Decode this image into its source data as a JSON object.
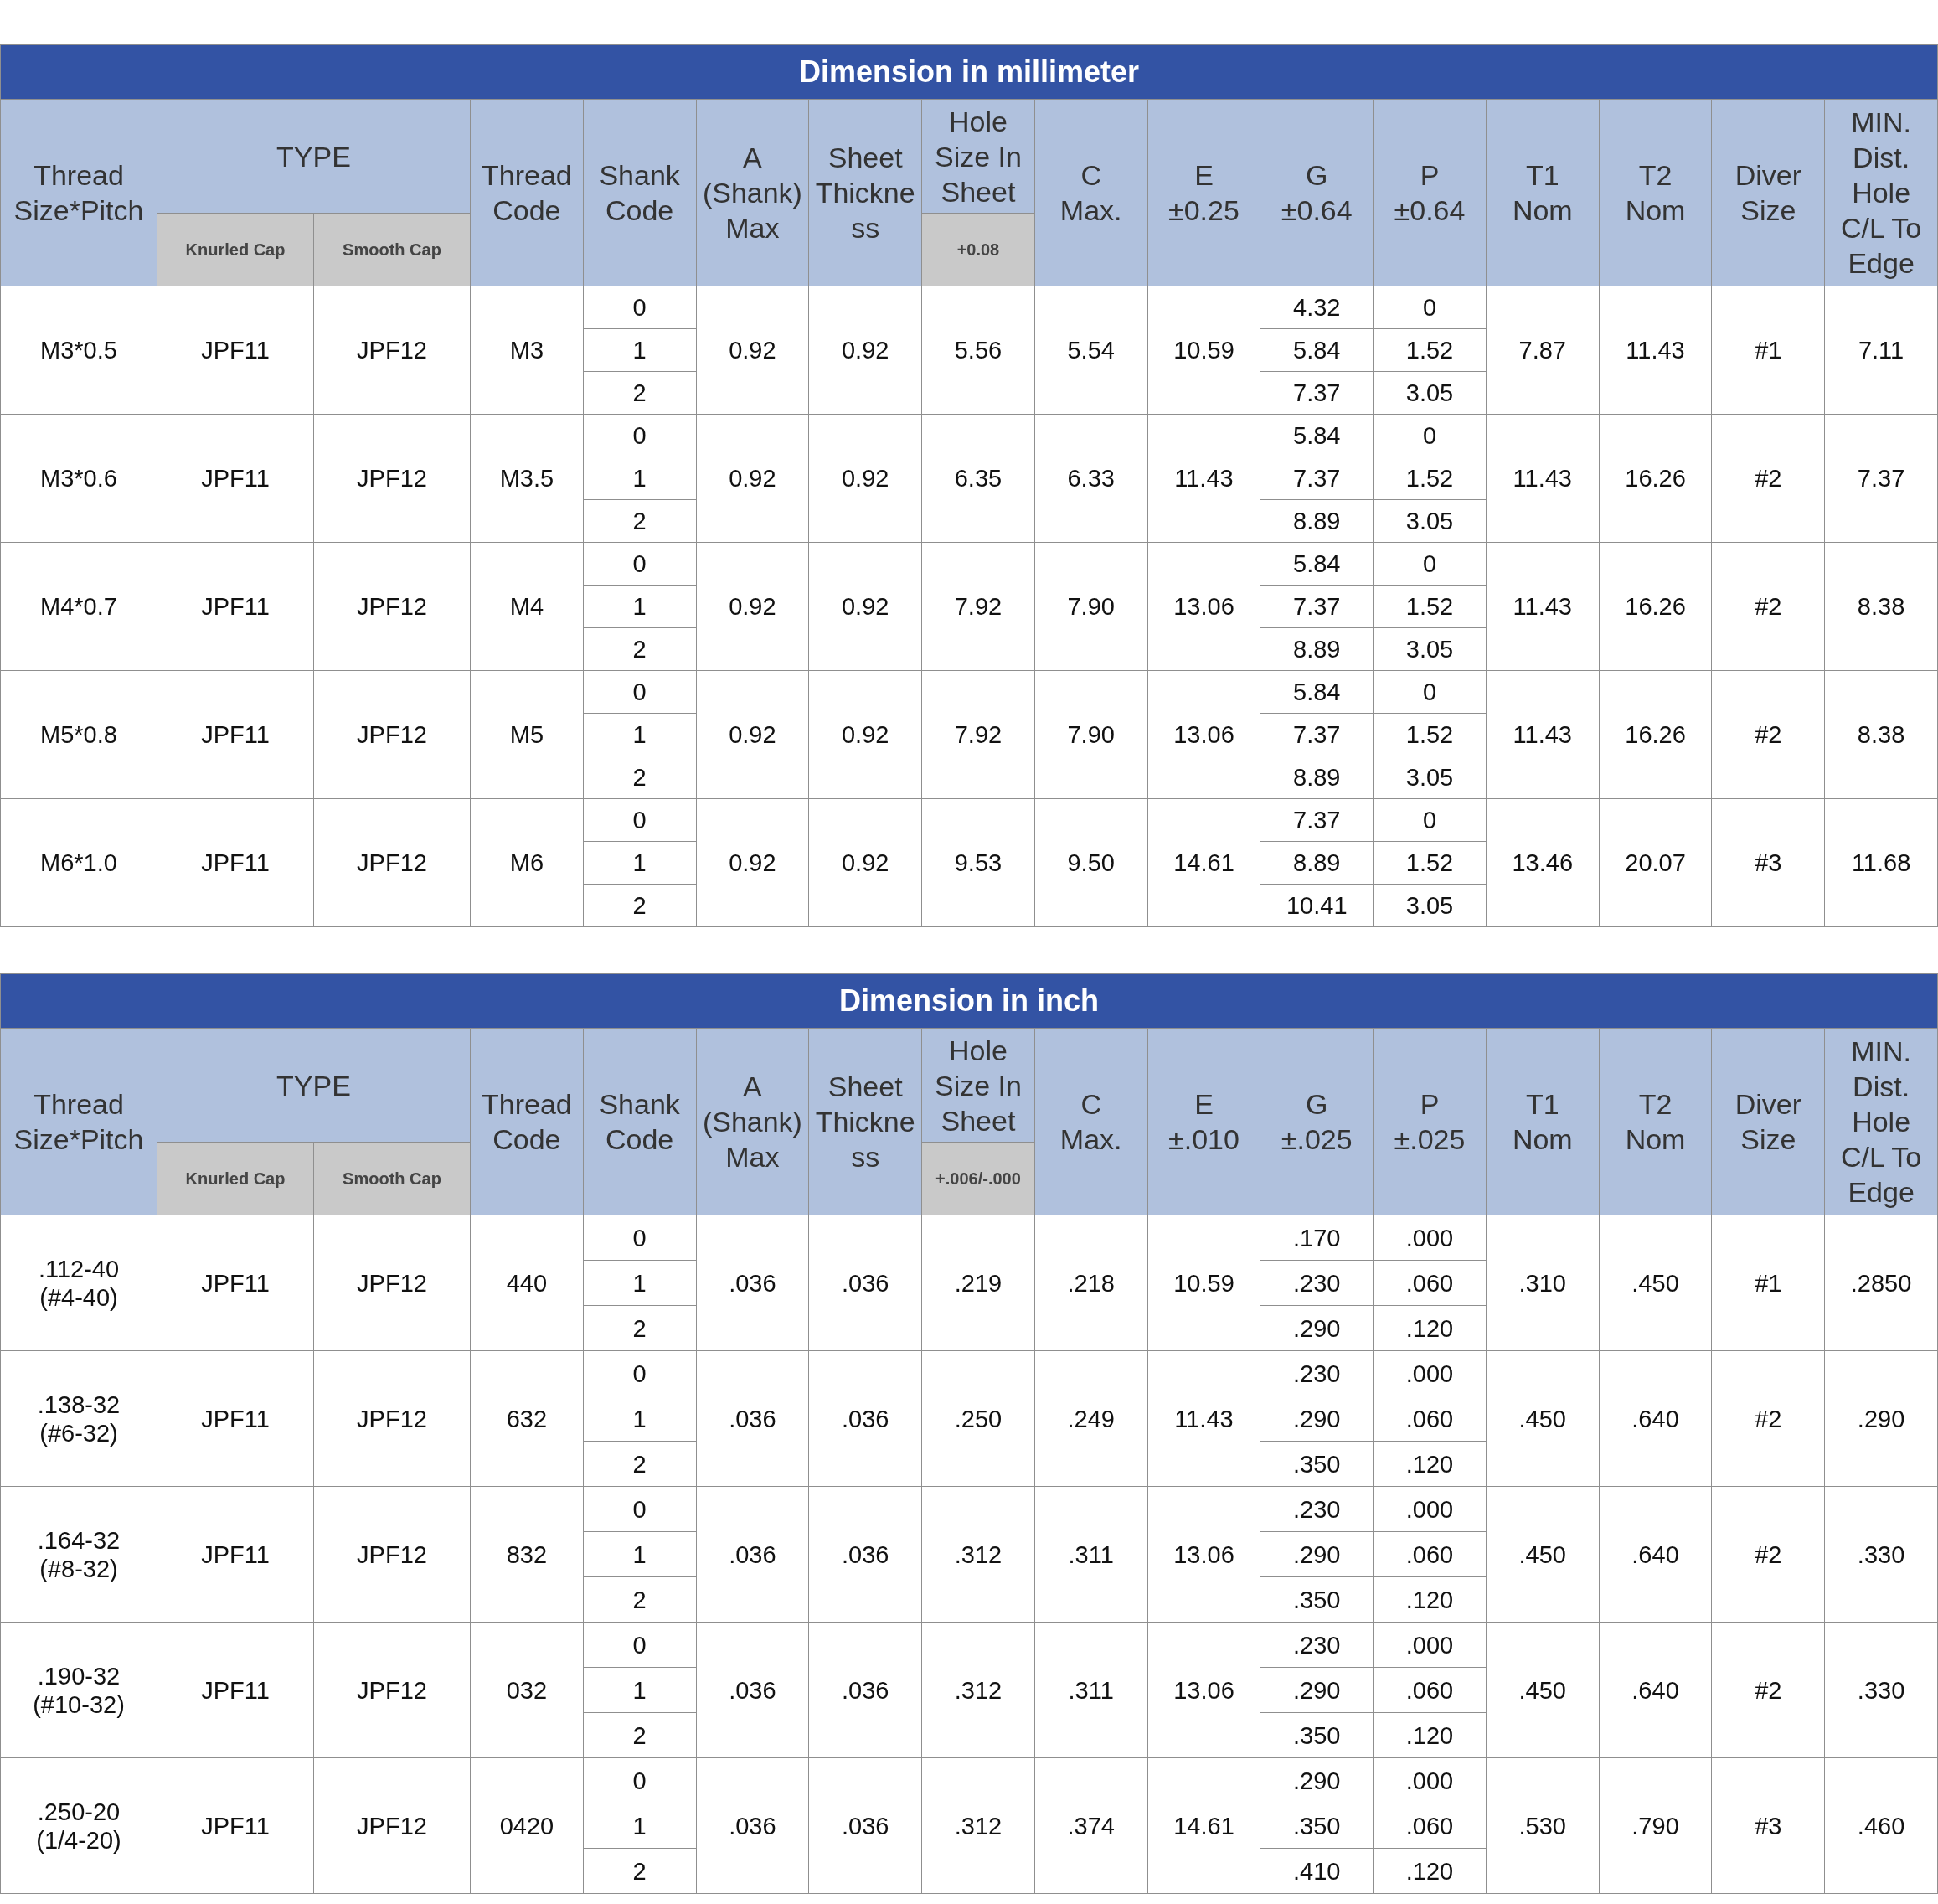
{
  "tables": [
    {
      "title": "Dimension in millimeter",
      "headers": {
        "thread_size": "Thread\nSize*Pitch",
        "type": "TYPE",
        "knurled": "Knurled Cap",
        "smooth": "Smooth Cap",
        "thread_code": "Thread\nCode",
        "shank_code": "Shank\nCode",
        "a": "A\n(Shank)\nMax",
        "sheet": "Sheet\nThickness",
        "hole": "Hole\nSize In\nSheet",
        "hole_tol": "+0.08",
        "c": "C\nMax.",
        "e": "E\n±0.25",
        "g": "G\n±0.64",
        "p": "P\n±0.64",
        "t1": "T1\nNom",
        "t2": "T2\nNom",
        "diver": "Diver\nSize",
        "min_dist": "MIN.\nDist.\nHole\nC/L To\nEdge"
      },
      "rows": [
        {
          "size": "M3*0.5",
          "knurled": "JPF11",
          "smooth": "JPF12",
          "thread_code": "M3",
          "shank_codes": [
            "0",
            "1",
            "2"
          ],
          "a": "0.92",
          "sheet": "0.92",
          "hole": "5.56",
          "c": "5.54",
          "e": "10.59",
          "g": [
            "4.32",
            "5.84",
            "7.37"
          ],
          "p": [
            "0",
            "1.52",
            "3.05"
          ],
          "t1": "7.87",
          "t2": "11.43",
          "diver": "#1",
          "min_dist": "7.11"
        },
        {
          "size": "M3*0.6",
          "knurled": "JPF11",
          "smooth": "JPF12",
          "thread_code": "M3.5",
          "shank_codes": [
            "0",
            "1",
            "2"
          ],
          "a": "0.92",
          "sheet": "0.92",
          "hole": "6.35",
          "c": "6.33",
          "e": "11.43",
          "g": [
            "5.84",
            "7.37",
            "8.89"
          ],
          "p": [
            "0",
            "1.52",
            "3.05"
          ],
          "t1": "11.43",
          "t2": "16.26",
          "diver": "#2",
          "min_dist": "7.37"
        },
        {
          "size": "M4*0.7",
          "knurled": "JPF11",
          "smooth": "JPF12",
          "thread_code": "M4",
          "shank_codes": [
            "0",
            "1",
            "2"
          ],
          "a": "0.92",
          "sheet": "0.92",
          "hole": "7.92",
          "c": "7.90",
          "e": "13.06",
          "g": [
            "5.84",
            "7.37",
            "8.89"
          ],
          "p": [
            "0",
            "1.52",
            "3.05"
          ],
          "t1": "11.43",
          "t2": "16.26",
          "diver": "#2",
          "min_dist": "8.38"
        },
        {
          "size": "M5*0.8",
          "knurled": "JPF11",
          "smooth": "JPF12",
          "thread_code": "M5",
          "shank_codes": [
            "0",
            "1",
            "2"
          ],
          "a": "0.92",
          "sheet": "0.92",
          "hole": "7.92",
          "c": "7.90",
          "e": "13.06",
          "g": [
            "5.84",
            "7.37",
            "8.89"
          ],
          "p": [
            "0",
            "1.52",
            "3.05"
          ],
          "t1": "11.43",
          "t2": "16.26",
          "diver": "#2",
          "min_dist": "8.38"
        },
        {
          "size": "M6*1.0",
          "knurled": "JPF11",
          "smooth": "JPF12",
          "thread_code": "M6",
          "shank_codes": [
            "0",
            "1",
            "2"
          ],
          "a": "0.92",
          "sheet": "0.92",
          "hole": "9.53",
          "c": "9.50",
          "e": "14.61",
          "g": [
            "7.37",
            "8.89",
            "10.41"
          ],
          "p": [
            "0",
            "1.52",
            "3.05"
          ],
          "t1": "13.46",
          "t2": "20.07",
          "diver": "#3",
          "min_dist": "11.68"
        }
      ]
    },
    {
      "title": "Dimension in inch",
      "headers": {
        "thread_size": "Thread\nSize*Pitch",
        "type": "TYPE",
        "knurled": "Knurled Cap",
        "smooth": "Smooth Cap",
        "thread_code": "Thread\nCode",
        "shank_code": "Shank\nCode",
        "a": "A\n(Shank)\nMax",
        "sheet": "Sheet\nThickness",
        "hole": "Hole\nSize In\nSheet",
        "hole_tol": "+.006/-.000",
        "c": "C\nMax.",
        "e": "E\n±.010",
        "g": "G\n±.025",
        "p": "P\n±.025",
        "t1": "T1\nNom",
        "t2": "T2\nNom",
        "diver": "Diver\nSize",
        "min_dist": "MIN.\nDist.\nHole\nC/L To\nEdge"
      },
      "rows": [
        {
          "size": ".112-40\n(#4-40)",
          "knurled": "JPF11",
          "smooth": "JPF12",
          "thread_code": "440",
          "shank_codes": [
            "0",
            "1",
            "2"
          ],
          "a": ".036",
          "sheet": ".036",
          "hole": ".219",
          "c": ".218",
          "e": "10.59",
          "g": [
            ".170",
            ".230",
            ".290"
          ],
          "p": [
            ".000",
            ".060",
            ".120"
          ],
          "t1": ".310",
          "t2": ".450",
          "diver": "#1",
          "min_dist": ".2850"
        },
        {
          "size": ".138-32\n(#6-32)",
          "knurled": "JPF11",
          "smooth": "JPF12",
          "thread_code": "632",
          "shank_codes": [
            "0",
            "1",
            "2"
          ],
          "a": ".036",
          "sheet": ".036",
          "hole": ".250",
          "c": ".249",
          "e": "11.43",
          "g": [
            ".230",
            ".290",
            ".350"
          ],
          "p": [
            ".000",
            ".060",
            ".120"
          ],
          "t1": ".450",
          "t2": ".640",
          "diver": "#2",
          "min_dist": ".290"
        },
        {
          "size": ".164-32\n(#8-32)",
          "knurled": "JPF11",
          "smooth": "JPF12",
          "thread_code": "832",
          "shank_codes": [
            "0",
            "1",
            "2"
          ],
          "a": ".036",
          "sheet": ".036",
          "hole": ".312",
          "c": ".311",
          "e": "13.06",
          "g": [
            ".230",
            ".290",
            ".350"
          ],
          "p": [
            ".000",
            ".060",
            ".120"
          ],
          "t1": ".450",
          "t2": ".640",
          "diver": "#2",
          "min_dist": ".330"
        },
        {
          "size": ".190-32\n(#10-32)",
          "knurled": "JPF11",
          "smooth": "JPF12",
          "thread_code": "032",
          "shank_codes": [
            "0",
            "1",
            "2"
          ],
          "a": ".036",
          "sheet": ".036",
          "hole": ".312",
          "c": ".311",
          "e": "13.06",
          "g": [
            ".230",
            ".290",
            ".350"
          ],
          "p": [
            ".000",
            ".060",
            ".120"
          ],
          "t1": ".450",
          "t2": ".640",
          "diver": "#2",
          "min_dist": ".330"
        },
        {
          "size": ".250-20\n(1/4-20)",
          "knurled": "JPF11",
          "smooth": "JPF12",
          "thread_code": "0420",
          "shank_codes": [
            "0",
            "1",
            "2"
          ],
          "a": ".036",
          "sheet": ".036",
          "hole": ".312",
          "c": ".374",
          "e": "14.61",
          "g": [
            ".290",
            ".350",
            ".410"
          ],
          "p": [
            ".000",
            ".060",
            ".120"
          ],
          "t1": ".530",
          "t2": ".790",
          "diver": "#3",
          "min_dist": ".460"
        }
      ]
    }
  ]
}
